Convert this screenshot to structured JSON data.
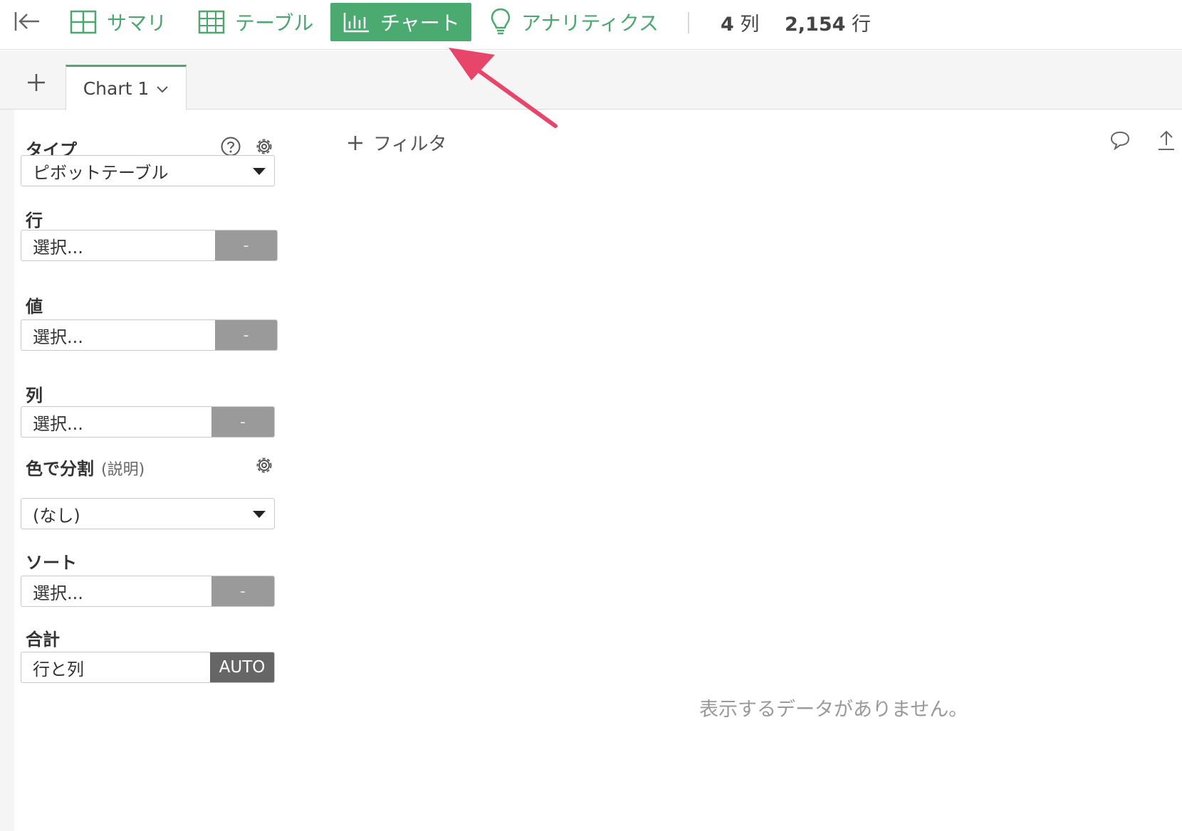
{
  "toolbar": {
    "collapse_icon": "collapse-left-icon",
    "tabs": [
      {
        "label": "サマリ",
        "icon": "summary-grid-icon",
        "active": false
      },
      {
        "label": "テーブル",
        "icon": "table-icon",
        "active": false
      },
      {
        "label": "チャート",
        "icon": "bar-chart-icon",
        "active": true
      },
      {
        "label": "アナリティクス",
        "icon": "lightbulb-icon",
        "active": false
      }
    ],
    "columns_count": "4",
    "columns_unit": "列",
    "rows_count": "2,154",
    "rows_unit": "行"
  },
  "chart_tabs": {
    "add_icon": "plus-icon",
    "current": "Chart 1",
    "dropdown_icon": "chevron-down-icon"
  },
  "panel": {
    "type_label": "タイプ",
    "type_value": "ピボットテーブル",
    "row_label": "行",
    "row_placeholder": "選択...",
    "row_btn": "-",
    "value_label": "値",
    "value_placeholder": "選択...",
    "value_btn": "-",
    "column_label": "列",
    "column_placeholder": "選択...",
    "column_btn": "-",
    "color_label": "色で分割",
    "color_sub": "(説明)",
    "color_value": "(なし)",
    "sort_label": "ソート",
    "sort_placeholder": "選択...",
    "sort_btn": "-",
    "total_label": "合計",
    "total_value": "行と列",
    "total_btn": "AUTO"
  },
  "main": {
    "filter_label": "フィルタ",
    "empty_message": "表示するデータがありません。"
  },
  "colors": {
    "accent": "#4aaa6f",
    "annotation_arrow": "#e8456b"
  }
}
